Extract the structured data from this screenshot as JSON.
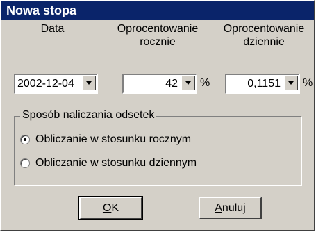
{
  "window": {
    "title": "Nowa stopa"
  },
  "columns": {
    "date_label": "Data",
    "annual_label": "Oprocentowanie\nrocznie",
    "daily_label": "Oprocentowanie\ndziennie"
  },
  "fields": {
    "date_value": "2002-12-04",
    "annual_value": "42",
    "annual_unit": "%",
    "daily_value": "0,1151",
    "daily_unit": "%"
  },
  "group": {
    "title": "Sposób naliczania odsetek",
    "options": [
      {
        "label": "Obliczanie w stosunku rocznym",
        "selected": true
      },
      {
        "label": "Obliczanie w stosunku dziennym",
        "selected": false
      }
    ]
  },
  "buttons": {
    "ok_first": "O",
    "ok_rest": "K",
    "cancel_first": "A",
    "cancel_rest": "nuluj"
  }
}
